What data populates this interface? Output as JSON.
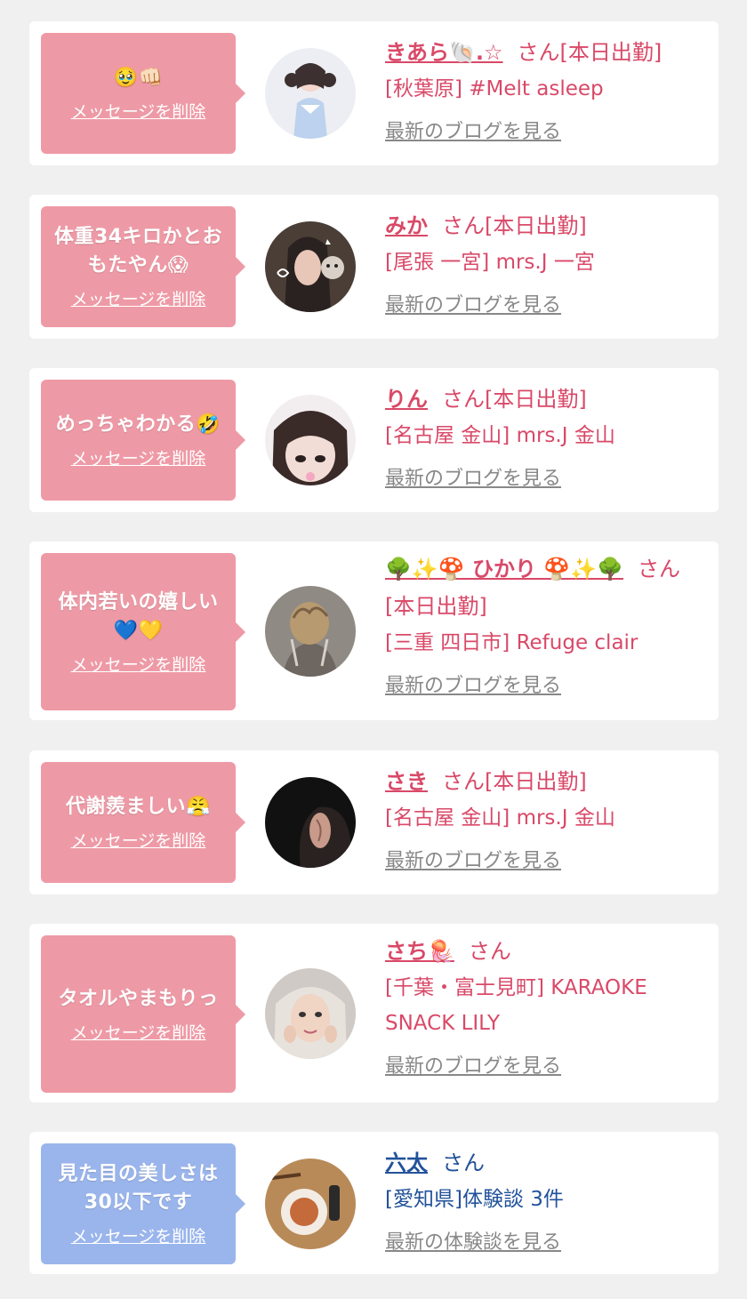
{
  "cards": [
    {
      "message": "🥹👊🏻",
      "delete_label": "メッセージを削除",
      "name": "きあら🐚.☆",
      "suffix": "さん[本日出勤]",
      "shop": "[秋葉原] #Melt asleep",
      "blog_label": "最新のブログを見る"
    },
    {
      "message": "体重34キロかとおもたやん😱",
      "delete_label": "メッセージを削除",
      "name": "みか",
      "suffix": "さん[本日出勤]",
      "shop": "[尾張 一宮] mrs.J 一宮",
      "blog_label": "最新のブログを見る"
    },
    {
      "message": "めっちゃわかる🤣",
      "delete_label": "メッセージを削除",
      "name": "りん",
      "suffix": "さん[本日出勤]",
      "shop": "[名古屋 金山] mrs.J 金山",
      "blog_label": "最新のブログを見る"
    },
    {
      "message": "体内若いの嬉しい💙💛",
      "delete_label": "メッセージを削除",
      "name": "🌳✨🍄 ひかり 🍄✨🌳",
      "suffix": "さん[本日出勤]",
      "shop": "[三重 四日市] Refuge clair",
      "blog_label": "最新のブログを見る"
    },
    {
      "message": "代謝羨ましい😤",
      "delete_label": "メッセージを削除",
      "name": "さき",
      "suffix": "さん[本日出勤]",
      "shop": "[名古屋 金山] mrs.J 金山",
      "blog_label": "最新のブログを見る"
    },
    {
      "message": "タオルやまもりっ",
      "delete_label": "メッセージを削除",
      "name": "さち🪼",
      "suffix": "さん",
      "shop": "[千葉・富士見町] KARAOKE SNACK LILY",
      "blog_label": "最新のブログを見る"
    },
    {
      "message": "見た目の美しさは30以下です",
      "delete_label": "メッセージを削除",
      "name": "六太",
      "suffix": "さん",
      "shop": "[愛知県]体験談 3件",
      "blog_label": "最新の体験談を見る"
    }
  ],
  "colors": {
    "page_background": "#f0f0f0",
    "bubble_pink": "#ee9aa6",
    "bubble_blue": "#9ab5ec",
    "name_pink": "#d94968",
    "name_blue": "#22529b",
    "link_gray": "#888888"
  }
}
